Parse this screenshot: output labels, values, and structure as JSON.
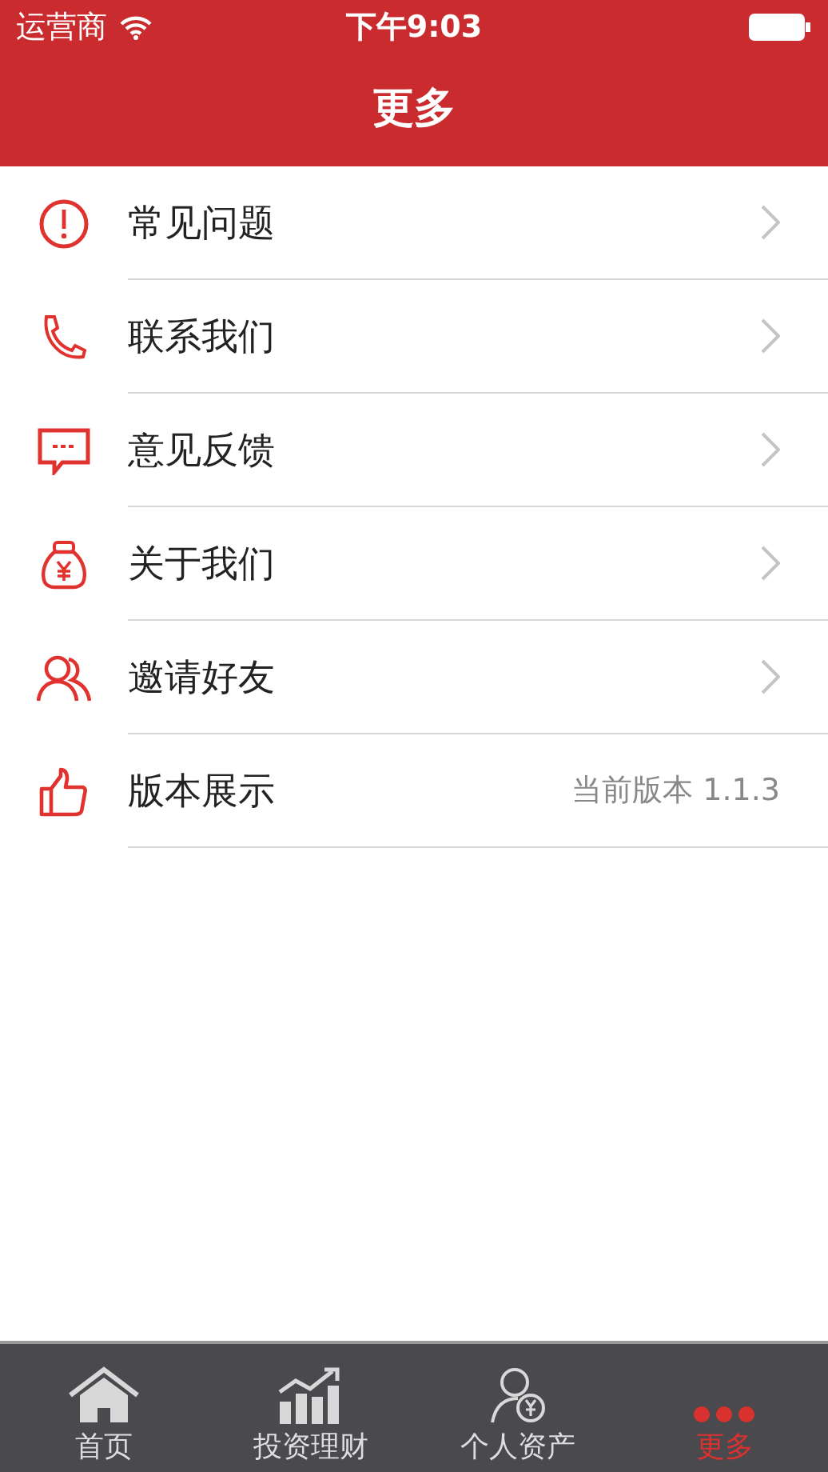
{
  "status_bar": {
    "carrier": "运营商",
    "time": "下午9:03"
  },
  "nav": {
    "title": "更多"
  },
  "menu": [
    {
      "label": "常见问题",
      "kind": "arrow"
    },
    {
      "label": "联系我们",
      "kind": "arrow"
    },
    {
      "label": "意见反馈",
      "kind": "arrow"
    },
    {
      "label": "关于我们",
      "kind": "arrow"
    },
    {
      "label": "邀请好友",
      "kind": "arrow"
    },
    {
      "label": "版本展示",
      "kind": "value",
      "value": "当前版本 1.1.3"
    }
  ],
  "tabs": [
    {
      "label": "首页",
      "selected": false
    },
    {
      "label": "投资理财",
      "selected": false
    },
    {
      "label": "个人资产",
      "selected": false
    },
    {
      "label": "更多",
      "selected": true
    }
  ]
}
